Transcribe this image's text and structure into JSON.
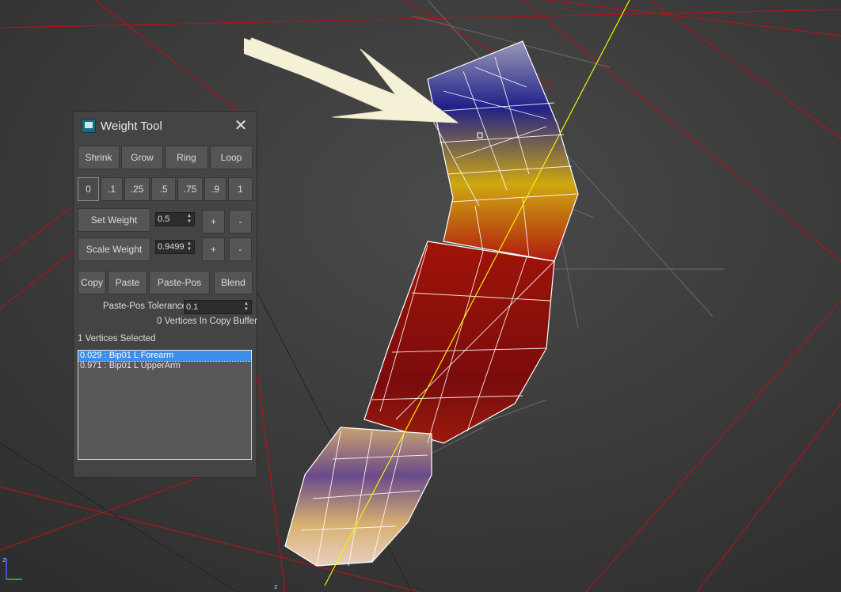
{
  "panel": {
    "title": "Weight Tool",
    "close_glyph": "✕",
    "app_icon": "3ds-max-icon",
    "buttons_row1": [
      "Shrink",
      "Grow",
      "Ring",
      "Loop"
    ],
    "presets": [
      "0",
      ".1",
      ".25",
      ".5",
      ".75",
      ".9",
      "1"
    ],
    "selected_preset": "0",
    "set_weight": {
      "label": "Set Weight",
      "value": "0.5",
      "plus": "+",
      "minus": "-"
    },
    "scale_weight": {
      "label": "Scale Weight",
      "value": "0.9499",
      "plus": "+",
      "minus": "-"
    },
    "buttons_copy": [
      "Copy",
      "Paste",
      "Paste-Pos",
      "Blend"
    ],
    "paste_pos_tolerance": {
      "label": "Paste-Pos Tolerance",
      "value": "0.1"
    },
    "copy_buffer_status": "0 Vertices In Copy Buffer",
    "selection_status": "1 Vertices Selected",
    "bone_list": [
      {
        "text": "0.029 : Bip01 L Forearm",
        "selected": true
      },
      {
        "text": "0.971 : Bip01 L UpperArm",
        "selected": false
      }
    ]
  },
  "viewport": {
    "axis_labels": {
      "z": "z",
      "x": "x"
    },
    "colors": {
      "background": "#3b3b3b",
      "grid_red": "#b4121b",
      "bone_yellow": "#f2f200",
      "wire": "#ffffff"
    }
  }
}
